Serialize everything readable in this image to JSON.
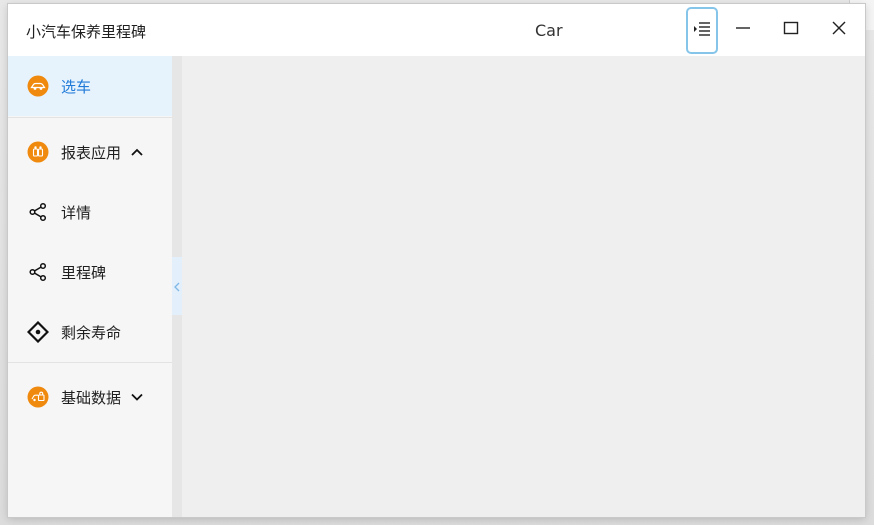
{
  "window": {
    "app_title": "小汽车保养里程碑",
    "car_label": "Car"
  },
  "titlebar_buttons": [
    {
      "name": "menu",
      "icon": "menu-indent-icon"
    },
    {
      "name": "minimize",
      "icon": "minimize-icon"
    },
    {
      "name": "maximize",
      "icon": "maximize-icon"
    },
    {
      "name": "close",
      "icon": "close-icon"
    }
  ],
  "sidebar": {
    "items": [
      {
        "label": "选车",
        "icon": "car-icon",
        "active": true
      },
      {
        "label": "报表应用",
        "icon": "report-icon",
        "expanded": true
      },
      {
        "label": "详情",
        "icon": "share-icon"
      },
      {
        "label": "里程碑",
        "icon": "share-icon"
      },
      {
        "label": "剩余寿命",
        "icon": "diamond-icon"
      },
      {
        "label": "基础数据",
        "icon": "database-icon",
        "expanded": false
      }
    ]
  },
  "colors": {
    "accent": "#1f7ad8",
    "icon_orange": "#f08a0f",
    "active_bg": "#e6f3fd",
    "focus_border": "#86c5ea"
  }
}
